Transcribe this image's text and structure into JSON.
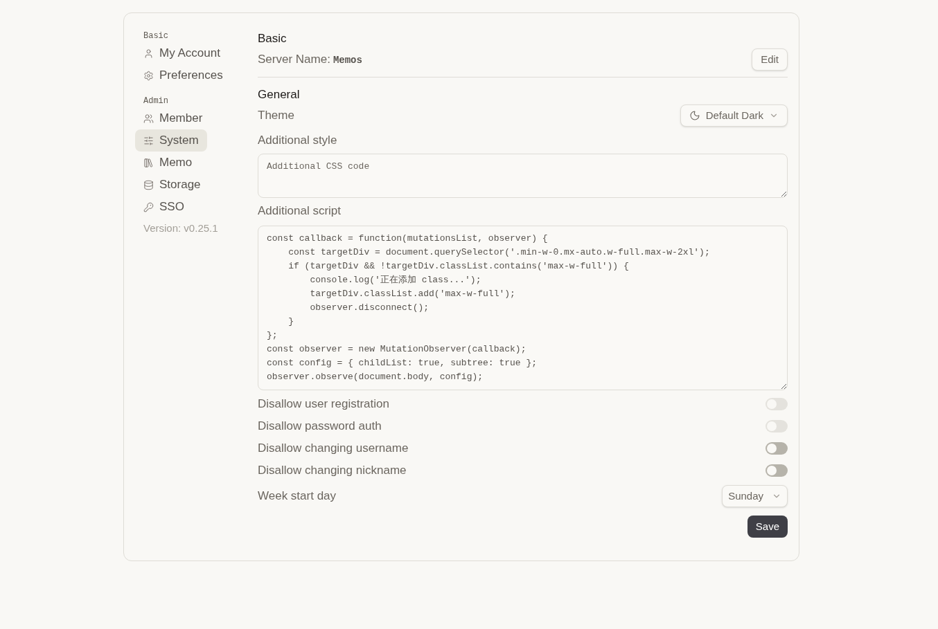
{
  "sidebar": {
    "sections": [
      {
        "title": "Basic",
        "items": [
          {
            "label": "My Account",
            "kind": "user",
            "selected": false
          },
          {
            "label": "Preferences",
            "kind": "gear",
            "selected": false
          }
        ]
      },
      {
        "title": "Admin",
        "items": [
          {
            "label": "Member",
            "kind": "users",
            "selected": false
          },
          {
            "label": "System",
            "kind": "sliders",
            "selected": true
          },
          {
            "label": "Memo",
            "kind": "library",
            "selected": false
          },
          {
            "label": "Storage",
            "kind": "database",
            "selected": false
          },
          {
            "label": "SSO",
            "kind": "key",
            "selected": false
          }
        ]
      }
    ],
    "version": "Version: v0.25.1"
  },
  "basic": {
    "title": "Basic",
    "server_label": "Server Name:",
    "server_name": "Memos",
    "edit_button": "Edit"
  },
  "general": {
    "title": "General",
    "theme_label": "Theme",
    "theme_value": "Default Dark",
    "style_label": "Additional style",
    "style_placeholder": "Additional CSS code",
    "script_label": "Additional script",
    "script_value": "const callback = function(mutationsList, observer) {\n    const targetDiv = document.querySelector('.min-w-0.mx-auto.w-full.max-w-2xl');\n    if (targetDiv && !targetDiv.classList.contains('max-w-full')) {\n        console.log('正在添加 class...');\n        targetDiv.classList.add('max-w-full');\n        observer.disconnect();\n    }\n};\nconst observer = new MutationObserver(callback);\nconst config = { childList: true, subtree: true };\nobserver.observe(document.body, config);",
    "toggles": [
      {
        "label": "Disallow user registration",
        "on": false,
        "disabled": true
      },
      {
        "label": "Disallow password auth",
        "on": false,
        "disabled": true
      },
      {
        "label": "Disallow changing username",
        "on": false,
        "disabled": false
      },
      {
        "label": "Disallow changing nickname",
        "on": false,
        "disabled": false
      }
    ],
    "week_label": "Week start day",
    "week_value": "Sunday",
    "save_button": "Save"
  }
}
